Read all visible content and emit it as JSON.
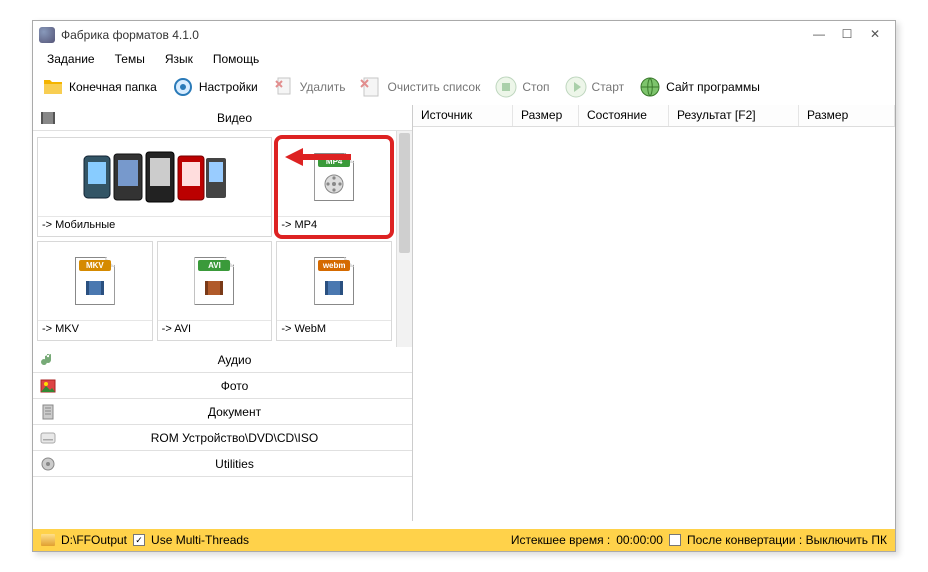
{
  "window": {
    "title": "Фабрика форматов 4.1.0"
  },
  "menu": {
    "items": [
      "Задание",
      "Темы",
      "Язык",
      "Помощь"
    ]
  },
  "toolbar": {
    "output_folder": "Конечная папка",
    "settings": "Настройки",
    "remove": "Удалить",
    "clear": "Очистить список",
    "stop": "Стоп",
    "start": "Старт",
    "website": "Сайт программы"
  },
  "categories": {
    "video": "Видео",
    "audio": "Аудио",
    "photo": "Фото",
    "document": "Документ",
    "rom": "ROM Устройство\\DVD\\CD\\ISO",
    "utilities": "Utilities"
  },
  "formats": {
    "mobile": "-> Мобильные",
    "mp4": "-> MP4",
    "mkv": "-> MKV",
    "avi": "-> AVI",
    "webm": "-> WebM",
    "mp4_tag": "MP4",
    "mkv_tag": "MKV",
    "avi_tag": "AVI",
    "webm_tag": "webm"
  },
  "columns": {
    "source": "Источник",
    "size": "Размер",
    "state": "Состояние",
    "result": "Результат [F2]",
    "size2": "Размер"
  },
  "status": {
    "output_path": "D:\\FFOutput",
    "multithreads": "Use Multi-Threads",
    "elapsed_label": "Истекшее время :",
    "elapsed_value": "00:00:00",
    "after_conv": "После конвертации : Выключить ПК"
  }
}
